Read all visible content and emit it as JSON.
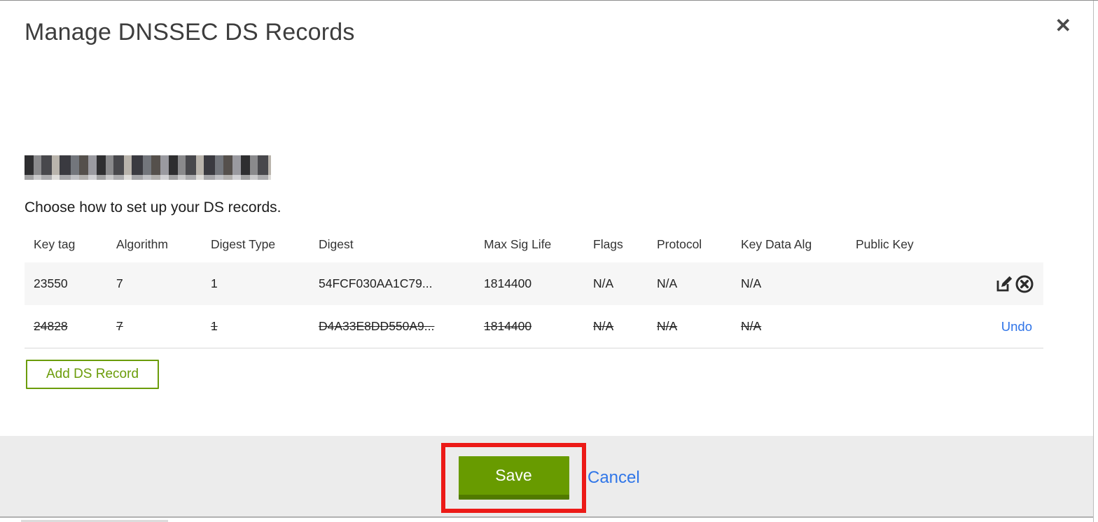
{
  "dialog": {
    "title": "Manage DNSSEC DS Records",
    "close_glyph": "✕",
    "instruction": "Choose how to set up your DS records.",
    "domain": {
      "redacted": true
    },
    "table": {
      "columns": [
        "Key tag",
        "Algorithm",
        "Digest Type",
        "Digest",
        "Max Sig Life",
        "Flags",
        "Protocol",
        "Key Data Alg",
        "Public Key"
      ],
      "rows": [
        {
          "state": "active",
          "cells": [
            "23550",
            "7",
            "1",
            "54FCF030AA1C79...",
            "1814400",
            "N/A",
            "N/A",
            "N/A",
            ""
          ],
          "actions": [
            "edit",
            "delete"
          ]
        },
        {
          "state": "deleted",
          "cells": [
            "24828",
            "7",
            "1",
            "D4A33E8DD550A9...",
            "1814400",
            "N/A",
            "N/A",
            "N/A",
            ""
          ],
          "undo_label": "Undo"
        }
      ]
    },
    "add_button_label": "Add DS Record",
    "footer": {
      "save_label": "Save",
      "cancel_label": "Cancel"
    }
  },
  "icons": {
    "close": "x-mark",
    "edit": "pencil-in-square",
    "delete": "x-in-circle"
  },
  "annotation": {
    "type": "red-highlight-box",
    "target": "save-button",
    "color": "#ec1a17"
  },
  "colors": {
    "save_green": "#689b00",
    "save_green_shadow": "#517a00",
    "add_button_green": "#6b9c0a",
    "link_blue": "#2f74e8",
    "annotation_red": "#ec1a17",
    "row_active_bg": "#f6f6f6",
    "footer_bg": "#ececec"
  }
}
